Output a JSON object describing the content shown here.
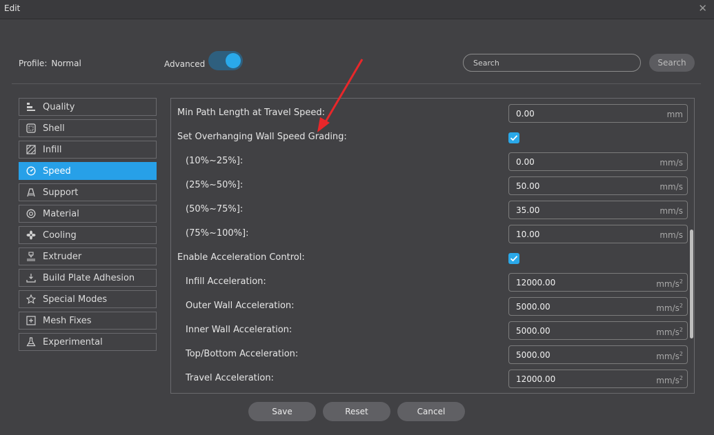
{
  "window": {
    "title": "Edit",
    "close_icon": "close-icon"
  },
  "header": {
    "profile_label": "Profile:",
    "profile_value": "Normal",
    "advanced_label": "Advanced",
    "advanced_on": true,
    "search_placeholder": "Search",
    "search_button": "Search"
  },
  "sidebar": {
    "items": [
      {
        "label": "Quality",
        "icon": "quality-icon",
        "active": false
      },
      {
        "label": "Shell",
        "icon": "shell-icon",
        "active": false
      },
      {
        "label": "Infill",
        "icon": "infill-icon",
        "active": false
      },
      {
        "label": "Speed",
        "icon": "speed-icon",
        "active": true
      },
      {
        "label": "Support",
        "icon": "support-icon",
        "active": false
      },
      {
        "label": "Material",
        "icon": "material-icon",
        "active": false
      },
      {
        "label": "Cooling",
        "icon": "fan-icon",
        "active": false
      },
      {
        "label": "Extruder",
        "icon": "extruder-icon",
        "active": false
      },
      {
        "label": "Build Plate Adhesion",
        "icon": "build-plate-icon",
        "active": false
      },
      {
        "label": "Special Modes",
        "icon": "star-icon",
        "active": false
      },
      {
        "label": "Mesh Fixes",
        "icon": "mesh-fix-icon",
        "active": false
      },
      {
        "label": "Experimental",
        "icon": "flask-icon",
        "active": false
      }
    ],
    "accent": "#27a0e8"
  },
  "settings": [
    {
      "label": "Min Path Length at Travel Speed:",
      "value": "0.00",
      "unit": "mm"
    },
    {
      "label": "Set Overhanging Wall Speed Grading:",
      "checked": true
    },
    {
      "label": "(10%~25%]:",
      "value": "0.00",
      "unit": "mm/s"
    },
    {
      "label": "(25%~50%]:",
      "value": "50.00",
      "unit": "mm/s"
    },
    {
      "label": "(50%~75%]:",
      "value": "35.00",
      "unit": "mm/s"
    },
    {
      "label": "(75%~100%]:",
      "value": "10.00",
      "unit": "mm/s"
    },
    {
      "label": "Enable Acceleration Control:",
      "checked": true
    },
    {
      "label": "Infill Acceleration:",
      "value": "12000.00",
      "unit": "mm/s",
      "unit_sup": "2"
    },
    {
      "label": "Outer Wall Acceleration:",
      "value": "5000.00",
      "unit": "mm/s",
      "unit_sup": "2"
    },
    {
      "label": "Inner Wall Acceleration:",
      "value": "5000.00",
      "unit": "mm/s",
      "unit_sup": "2"
    },
    {
      "label": "Top/Bottom Acceleration:",
      "value": "5000.00",
      "unit": "mm/s",
      "unit_sup": "2"
    },
    {
      "label": "Travel Acceleration:",
      "value": "12000.00",
      "unit": "mm/s",
      "unit_sup": "2"
    }
  ],
  "footer": {
    "save": "Save",
    "reset": "Reset",
    "cancel": "Cancel"
  }
}
